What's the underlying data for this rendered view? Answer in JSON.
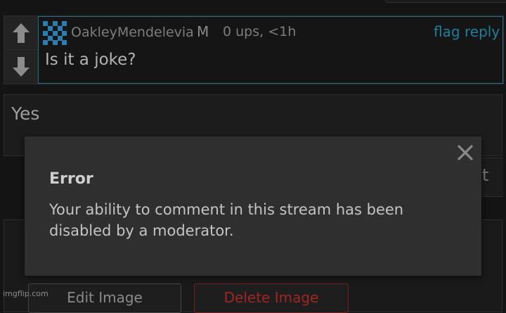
{
  "comment": {
    "username": "OakleyMendelevia",
    "badge": "M",
    "meta": "0 ups, <1h",
    "flag_label": "flag",
    "reply_label": "reply",
    "text": "Is it a joke?",
    "icons": {
      "upvote": "arrow-up-icon",
      "downvote": "arrow-down-icon",
      "avatar": "checker-avatar"
    }
  },
  "reply_box": {
    "value": "Yes"
  },
  "post_button": {
    "label_visible": "t"
  },
  "image_buttons": {
    "edit_label": "Edit Image",
    "delete_label": "Delete Image"
  },
  "modal": {
    "title": "Error",
    "message": "Your ability to comment in this stream has been disabled by a moderator.",
    "close_icon": "close-icon"
  },
  "watermark": "imgflip.com",
  "colors": {
    "link": "#1e7f9c",
    "accent_border": "#1e6f86",
    "modal_bg": "#2f2f2f",
    "delete": "#a02525"
  }
}
